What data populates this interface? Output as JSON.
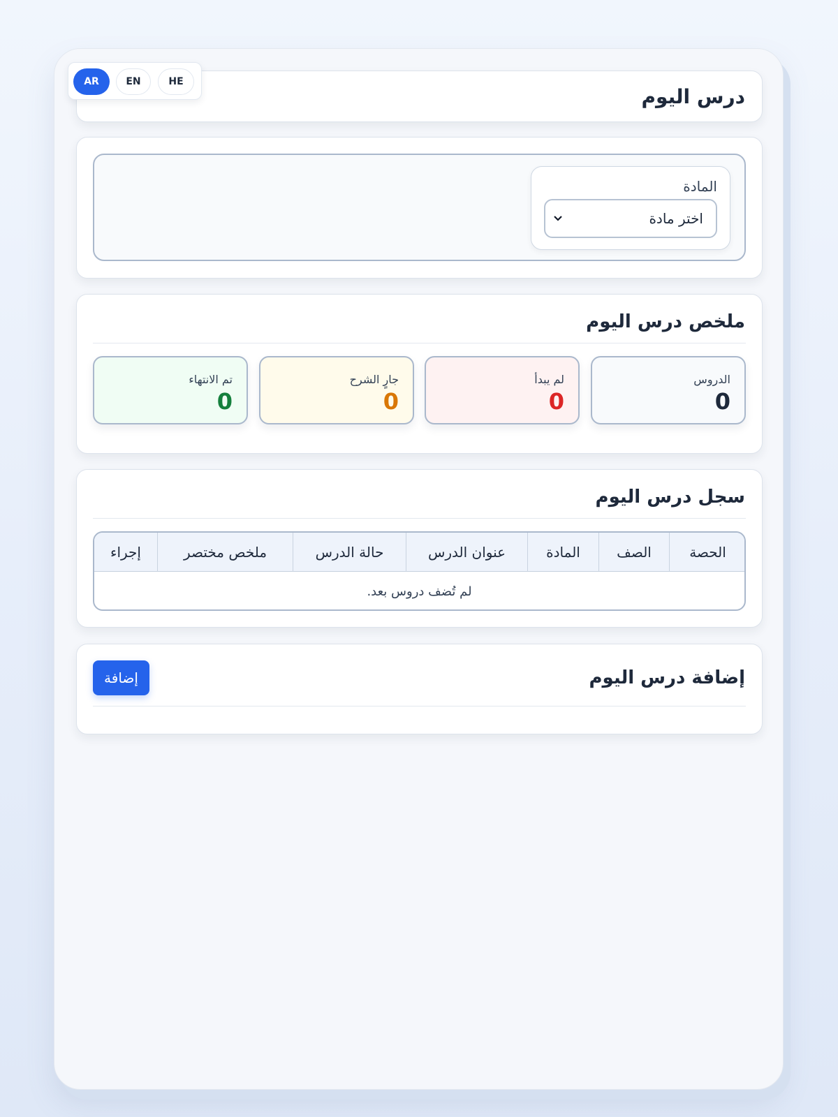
{
  "languages": [
    {
      "label": "AR",
      "active": true
    },
    {
      "label": "EN",
      "active": false
    },
    {
      "label": "HE",
      "active": false
    }
  ],
  "header": {
    "title": "درس اليوم"
  },
  "filter": {
    "subject_label": "المادة",
    "subject_select_value": "اختر مادة"
  },
  "summary": {
    "title": "ملخص درس اليوم",
    "stats": [
      {
        "label": "الدروس",
        "value": "0",
        "color": "#1e293b",
        "bg": "#f8fafc"
      },
      {
        "label": "لم يبدأ",
        "value": "0",
        "color": "#dc2626",
        "bg": "#fef2f2"
      },
      {
        "label": "جارٍ الشرح",
        "value": "0",
        "color": "#d97706",
        "bg": "#fffbeb"
      },
      {
        "label": "تم الانتهاء",
        "value": "0",
        "color": "#15803d",
        "bg": "#f0fdf4"
      }
    ]
  },
  "log": {
    "title": "سجل درس اليوم",
    "columns": [
      "الحصة",
      "الصف",
      "المادة",
      "عنوان الدرس",
      "حالة الدرس",
      "ملخص مختصر",
      "إجراء"
    ],
    "empty_message": "لم تُضف دروس بعد."
  },
  "add_section": {
    "title": "إضافة درس اليوم",
    "add_button_label": "إضافة"
  },
  "colors": {
    "accent": "#2563eb",
    "card_border": "#dde3ec"
  }
}
